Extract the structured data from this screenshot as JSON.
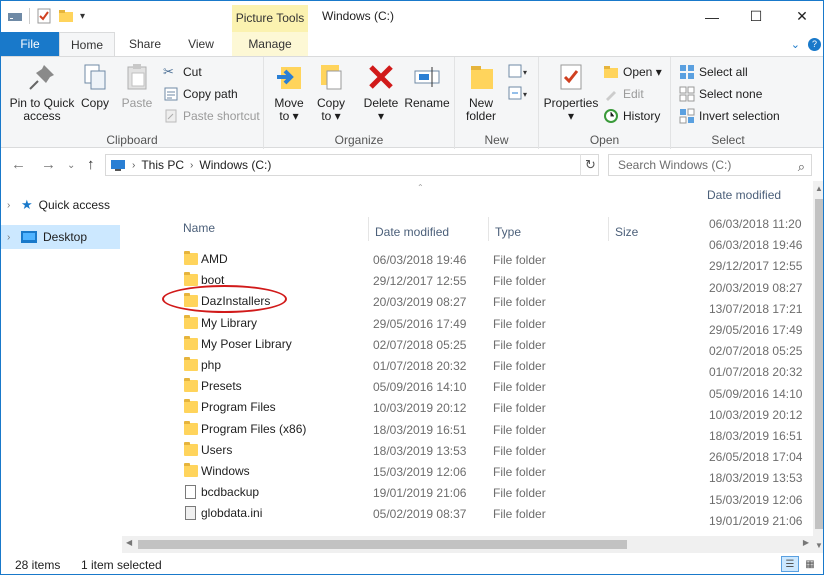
{
  "window": {
    "title": "Windows (C:)",
    "contextual_tab_title": "Picture Tools",
    "controls": {
      "minimize": "—",
      "maximize": "☐",
      "close": "✕"
    }
  },
  "ribbon_tabs": [
    {
      "label": "File"
    },
    {
      "label": "Home"
    },
    {
      "label": "Share"
    },
    {
      "label": "View"
    },
    {
      "label": "Manage"
    }
  ],
  "ribbon": {
    "clipboard": {
      "label": "Clipboard",
      "pin_label_1": "Pin to Quick",
      "pin_label_2": "access",
      "copy": "Copy",
      "paste": "Paste",
      "cut": "Cut",
      "copy_path": "Copy path",
      "paste_shortcut": "Paste shortcut"
    },
    "organize": {
      "label": "Organize",
      "move_to_1": "Move",
      "move_to_2": "to ▾",
      "copy_to_1": "Copy",
      "copy_to_2": "to ▾",
      "delete_1": "Delete",
      "delete_2": "▾",
      "rename": "Rename"
    },
    "new": {
      "label": "New",
      "new_folder_1": "New",
      "new_folder_2": "folder"
    },
    "open": {
      "label": "Open",
      "properties_1": "Properties",
      "properties_2": "▾",
      "open": "Open ▾",
      "edit": "Edit",
      "history": "History"
    },
    "select": {
      "label": "Select",
      "select_all": "Select all",
      "select_none": "Select none",
      "invert": "Invert selection"
    }
  },
  "address": {
    "crumbs": [
      "This PC",
      "Windows (C:)"
    ],
    "search_placeholder": "Search Windows (C:)"
  },
  "nav_pane": [
    {
      "label": "Quick access",
      "selected": false
    },
    {
      "label": "Desktop",
      "selected": true
    }
  ],
  "columns": {
    "name": "Name",
    "date": "Date modified",
    "type": "Type",
    "size": "Size"
  },
  "files": [
    {
      "name": "AMD",
      "date": "06/03/2018 19:46",
      "type": "File folder",
      "kind": "folder"
    },
    {
      "name": "boot",
      "date": "29/12/2017 12:55",
      "type": "File folder",
      "kind": "folder"
    },
    {
      "name": "DazInstallers",
      "date": "20/03/2019 08:27",
      "type": "File folder",
      "kind": "folder"
    },
    {
      "name": "My Library",
      "date": "29/05/2016 17:49",
      "type": "File folder",
      "kind": "folder"
    },
    {
      "name": "My Poser Library",
      "date": "02/07/2018 05:25",
      "type": "File folder",
      "kind": "folder"
    },
    {
      "name": "php",
      "date": "01/07/2018 20:32",
      "type": "File folder",
      "kind": "folder"
    },
    {
      "name": "Presets",
      "date": "05/09/2016 14:10",
      "type": "File folder",
      "kind": "folder"
    },
    {
      "name": "Program Files",
      "date": "10/03/2019 20:12",
      "type": "File folder",
      "kind": "folder"
    },
    {
      "name": "Program Files (x86)",
      "date": "18/03/2019 16:51",
      "type": "File folder",
      "kind": "folder"
    },
    {
      "name": "Users",
      "date": "18/03/2019 13:53",
      "type": "File folder",
      "kind": "folder"
    },
    {
      "name": "Windows",
      "date": "15/03/2019 12:06",
      "type": "File folder",
      "kind": "folder"
    },
    {
      "name": "bcdbackup",
      "date": "19/01/2019 21:06",
      "type": "File folder",
      "kind": "file"
    },
    {
      "name": "globdata.ini",
      "date": "05/02/2019 08:37",
      "type": "File folder",
      "kind": "ini"
    }
  ],
  "right_column": {
    "header": "Date modified",
    "values": [
      "06/03/2018 11:20",
      "06/03/2018 19:46",
      "29/12/2017 12:55",
      "20/03/2019 08:27",
      "13/07/2018 17:21",
      "29/05/2016 17:49",
      "02/07/2018 05:25",
      "01/07/2018 20:32",
      "05/09/2016 14:10",
      "10/03/2019 20:12",
      "18/03/2019 16:51",
      "26/05/2018 17:04",
      "18/03/2019 13:53",
      "15/03/2019 12:06",
      "19/01/2019 21:06"
    ]
  },
  "status": {
    "items": "28 items",
    "selected": "1 item selected"
  },
  "colors": {
    "accent": "#1979ca",
    "selection": "#cce8ff",
    "folder": "#ffd45c",
    "annotation": "#d11a1a"
  }
}
